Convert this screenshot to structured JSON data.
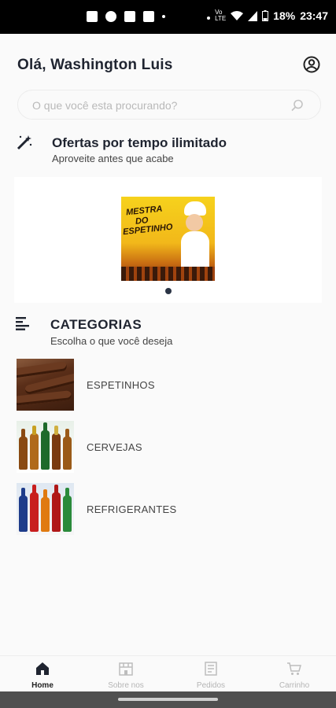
{
  "status_bar": {
    "battery": "18%",
    "time": "23:47"
  },
  "header": {
    "greeting": "Olá, Washington Luis"
  },
  "search": {
    "placeholder": "O que você esta procurando?"
  },
  "offers": {
    "title": "Ofertas por tempo ilimitado",
    "subtitle": "Aproveite antes que acabe",
    "banner_text": [
      "MESTRA",
      "DO",
      "ESPETINHO"
    ]
  },
  "categories": {
    "title": "CATEGORIAS",
    "subtitle": "Escolha o que você deseja",
    "items": [
      {
        "label": "ESPETINHOS"
      },
      {
        "label": "CERVEJAS"
      },
      {
        "label": "REFRIGERANTES"
      }
    ]
  },
  "bottom_nav": {
    "items": [
      {
        "label": "Home",
        "icon": "home-icon",
        "active": true
      },
      {
        "label": "Sobre nos",
        "icon": "store-icon",
        "active": false
      },
      {
        "label": "Pedidos",
        "icon": "orders-icon",
        "active": false
      },
      {
        "label": "Carrinho",
        "icon": "cart-icon",
        "active": false
      }
    ]
  },
  "colors": {
    "accent": "#2b3445",
    "text": "#1f2430",
    "inactive": "#b5b5b5"
  }
}
